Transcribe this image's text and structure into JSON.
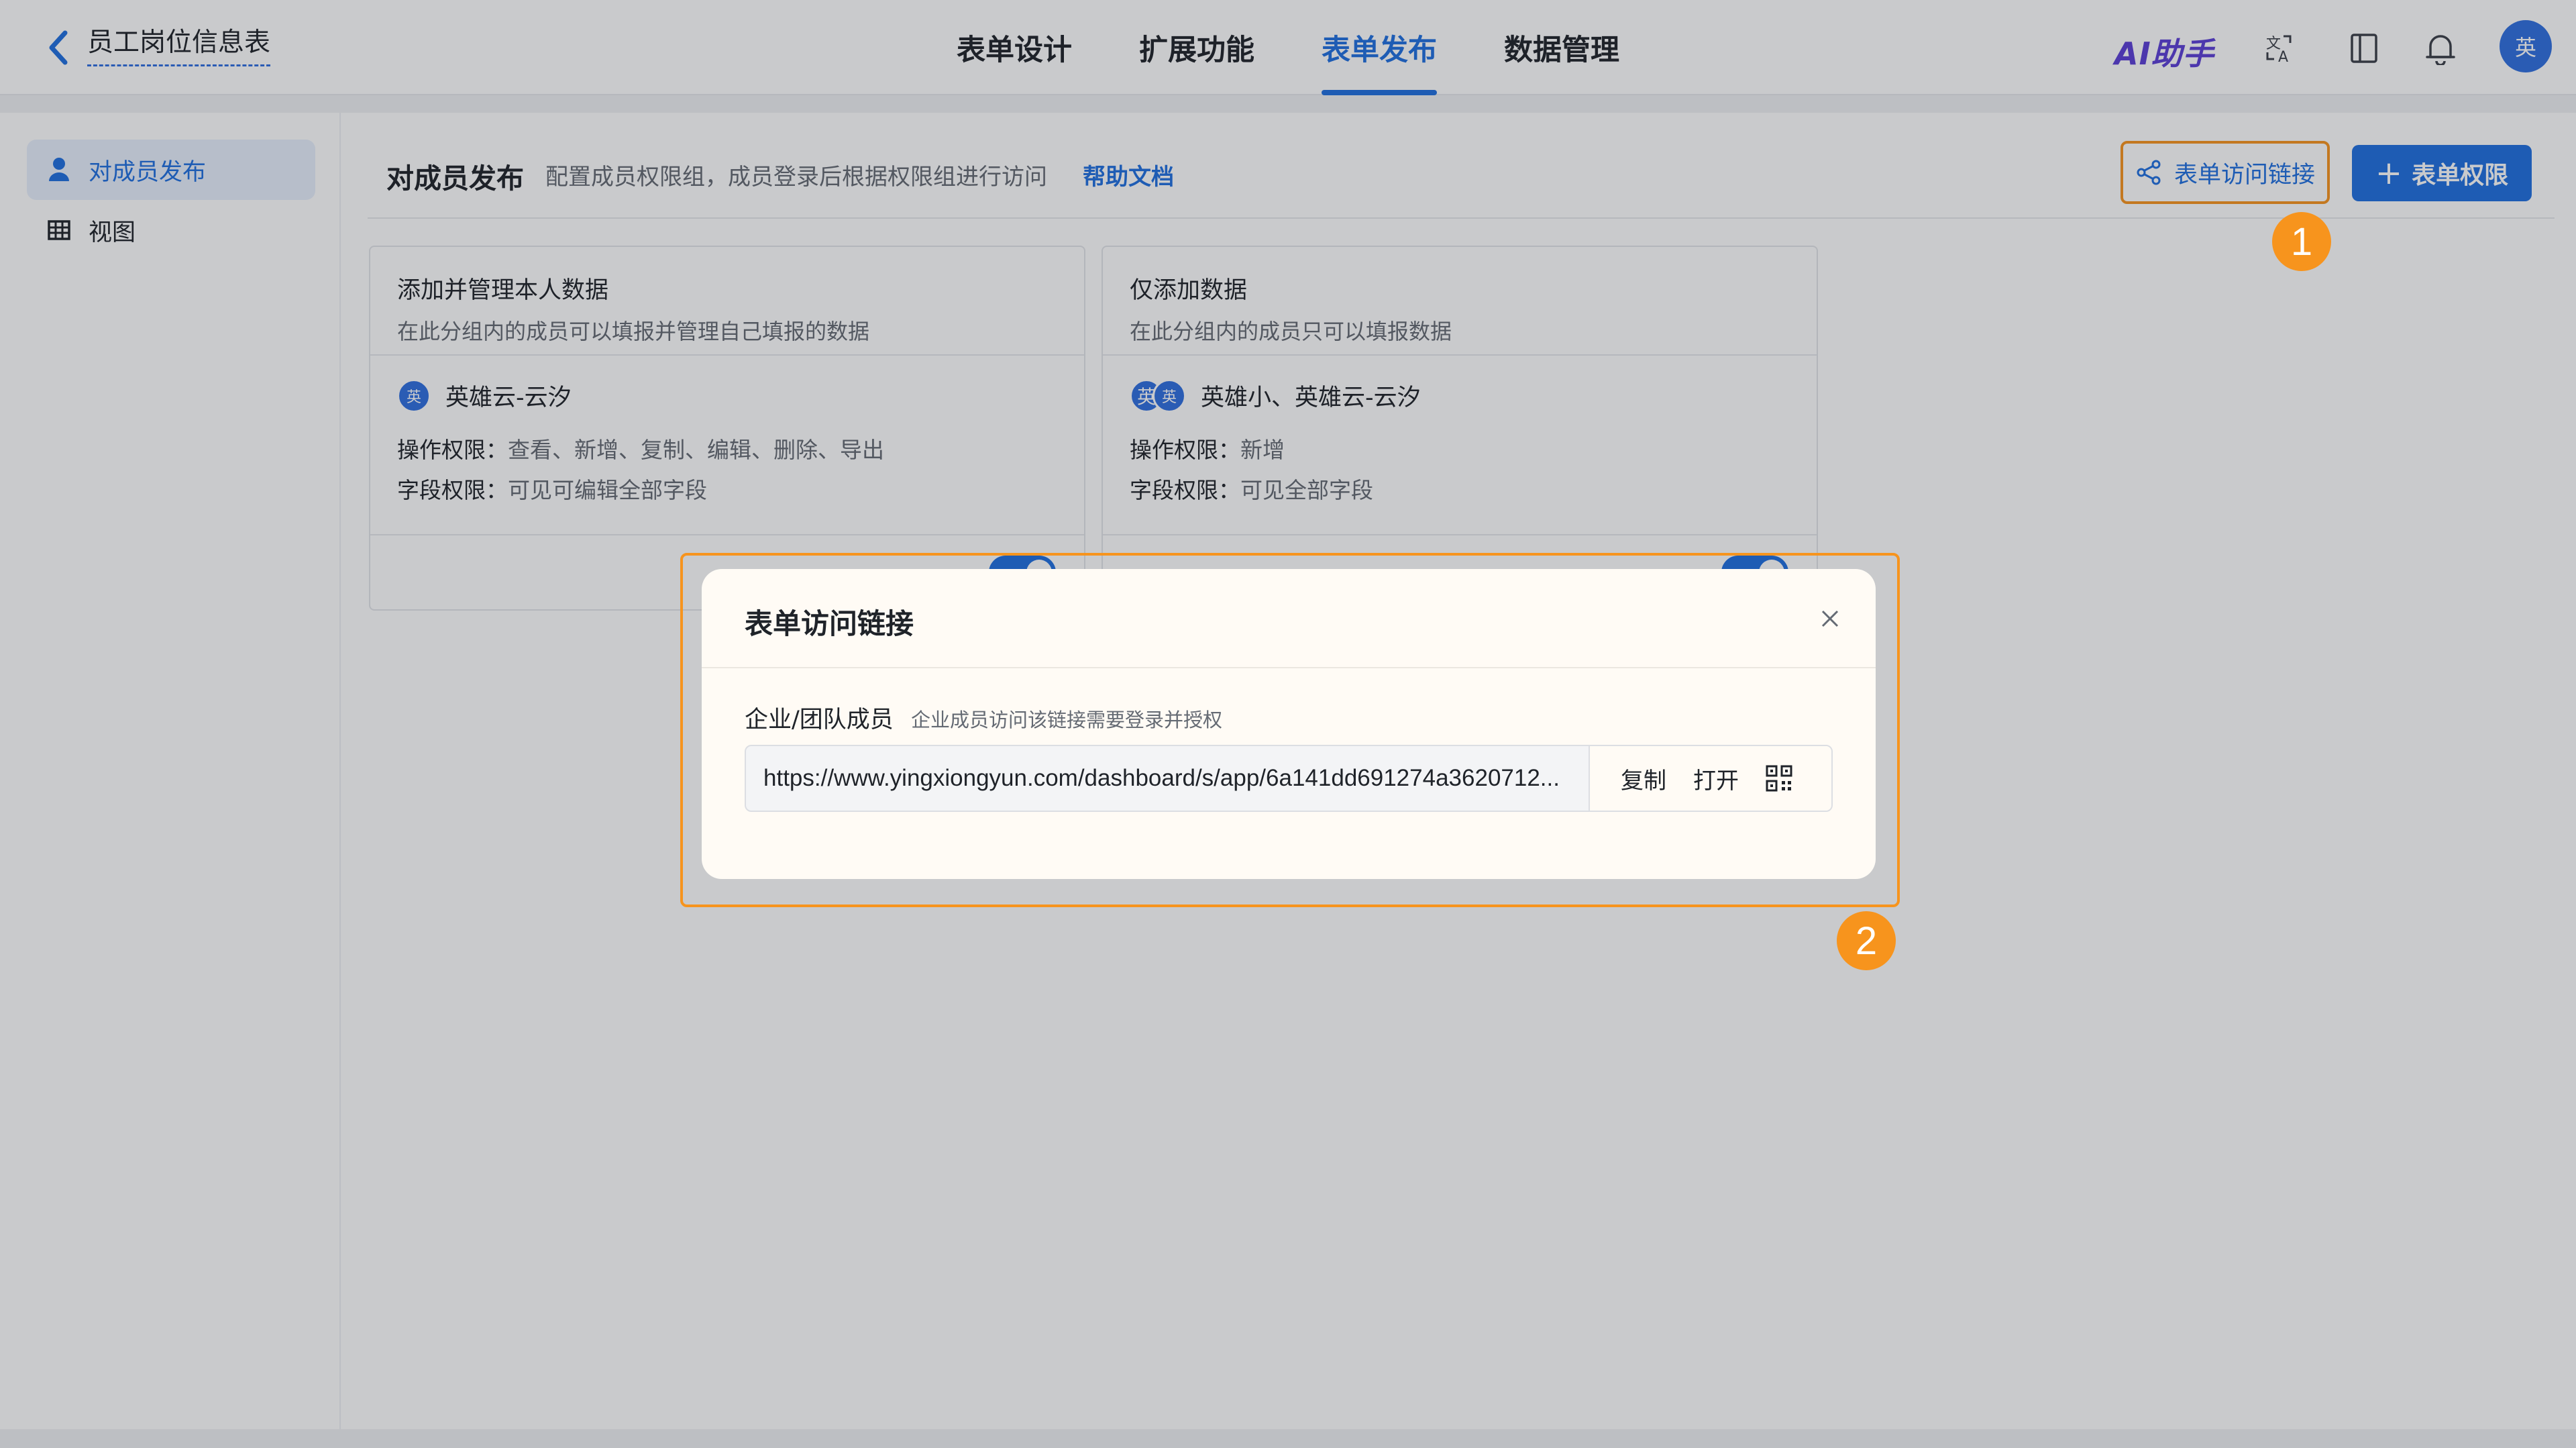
{
  "header": {
    "title": "员工岗位信息表",
    "tabs": [
      "表单设计",
      "扩展功能",
      "表单发布",
      "数据管理"
    ],
    "active_tab": "表单发布",
    "ai_label": "AI助手",
    "avatar_text": "英"
  },
  "sidebar": {
    "items": [
      {
        "label": "对成员发布",
        "icon": "user-icon",
        "active": true
      },
      {
        "label": "视图",
        "icon": "table-icon",
        "active": false
      }
    ]
  },
  "main": {
    "title": "对成员发布",
    "description": "配置成员权限组，成员登录后根据权限组进行访问",
    "help_link": "帮助文档",
    "link_button": "表单访问链接",
    "perm_button": "表单权限",
    "badge1": "1",
    "badge2": "2"
  },
  "cards": [
    {
      "title": "添加并管理本人数据",
      "subtitle": "在此分组内的成员可以填报并管理自己填报的数据",
      "avatars": [
        "英"
      ],
      "members": "英雄云-云汐",
      "op_label": "操作权限：",
      "op_value": "查看、新增、复制、编辑、删除、导出",
      "field_label": "字段权限：",
      "field_value": "可见可编辑全部字段"
    },
    {
      "title": "仅添加数据",
      "subtitle": "在此分组内的成员只可以填报数据",
      "avatars": [
        "英",
        "英"
      ],
      "members": "英雄小、英雄云-云汐",
      "op_label": "操作权限：",
      "op_value": "新增",
      "field_label": "字段权限：",
      "field_value": "可见全部字段"
    }
  ],
  "modal": {
    "title": "表单访问链接",
    "field_label": "企业/团队成员",
    "field_hint": "企业成员访问该链接需要登录并授权",
    "url": "https://www.yingxiongyun.com/dashboard/s/app/6a141dd691274a3620712...",
    "copy": "复制",
    "open": "打开"
  },
  "colors": {
    "accent": "#1f6fe0",
    "highlight": "#f7941d",
    "ai": "#5b3fd6"
  }
}
